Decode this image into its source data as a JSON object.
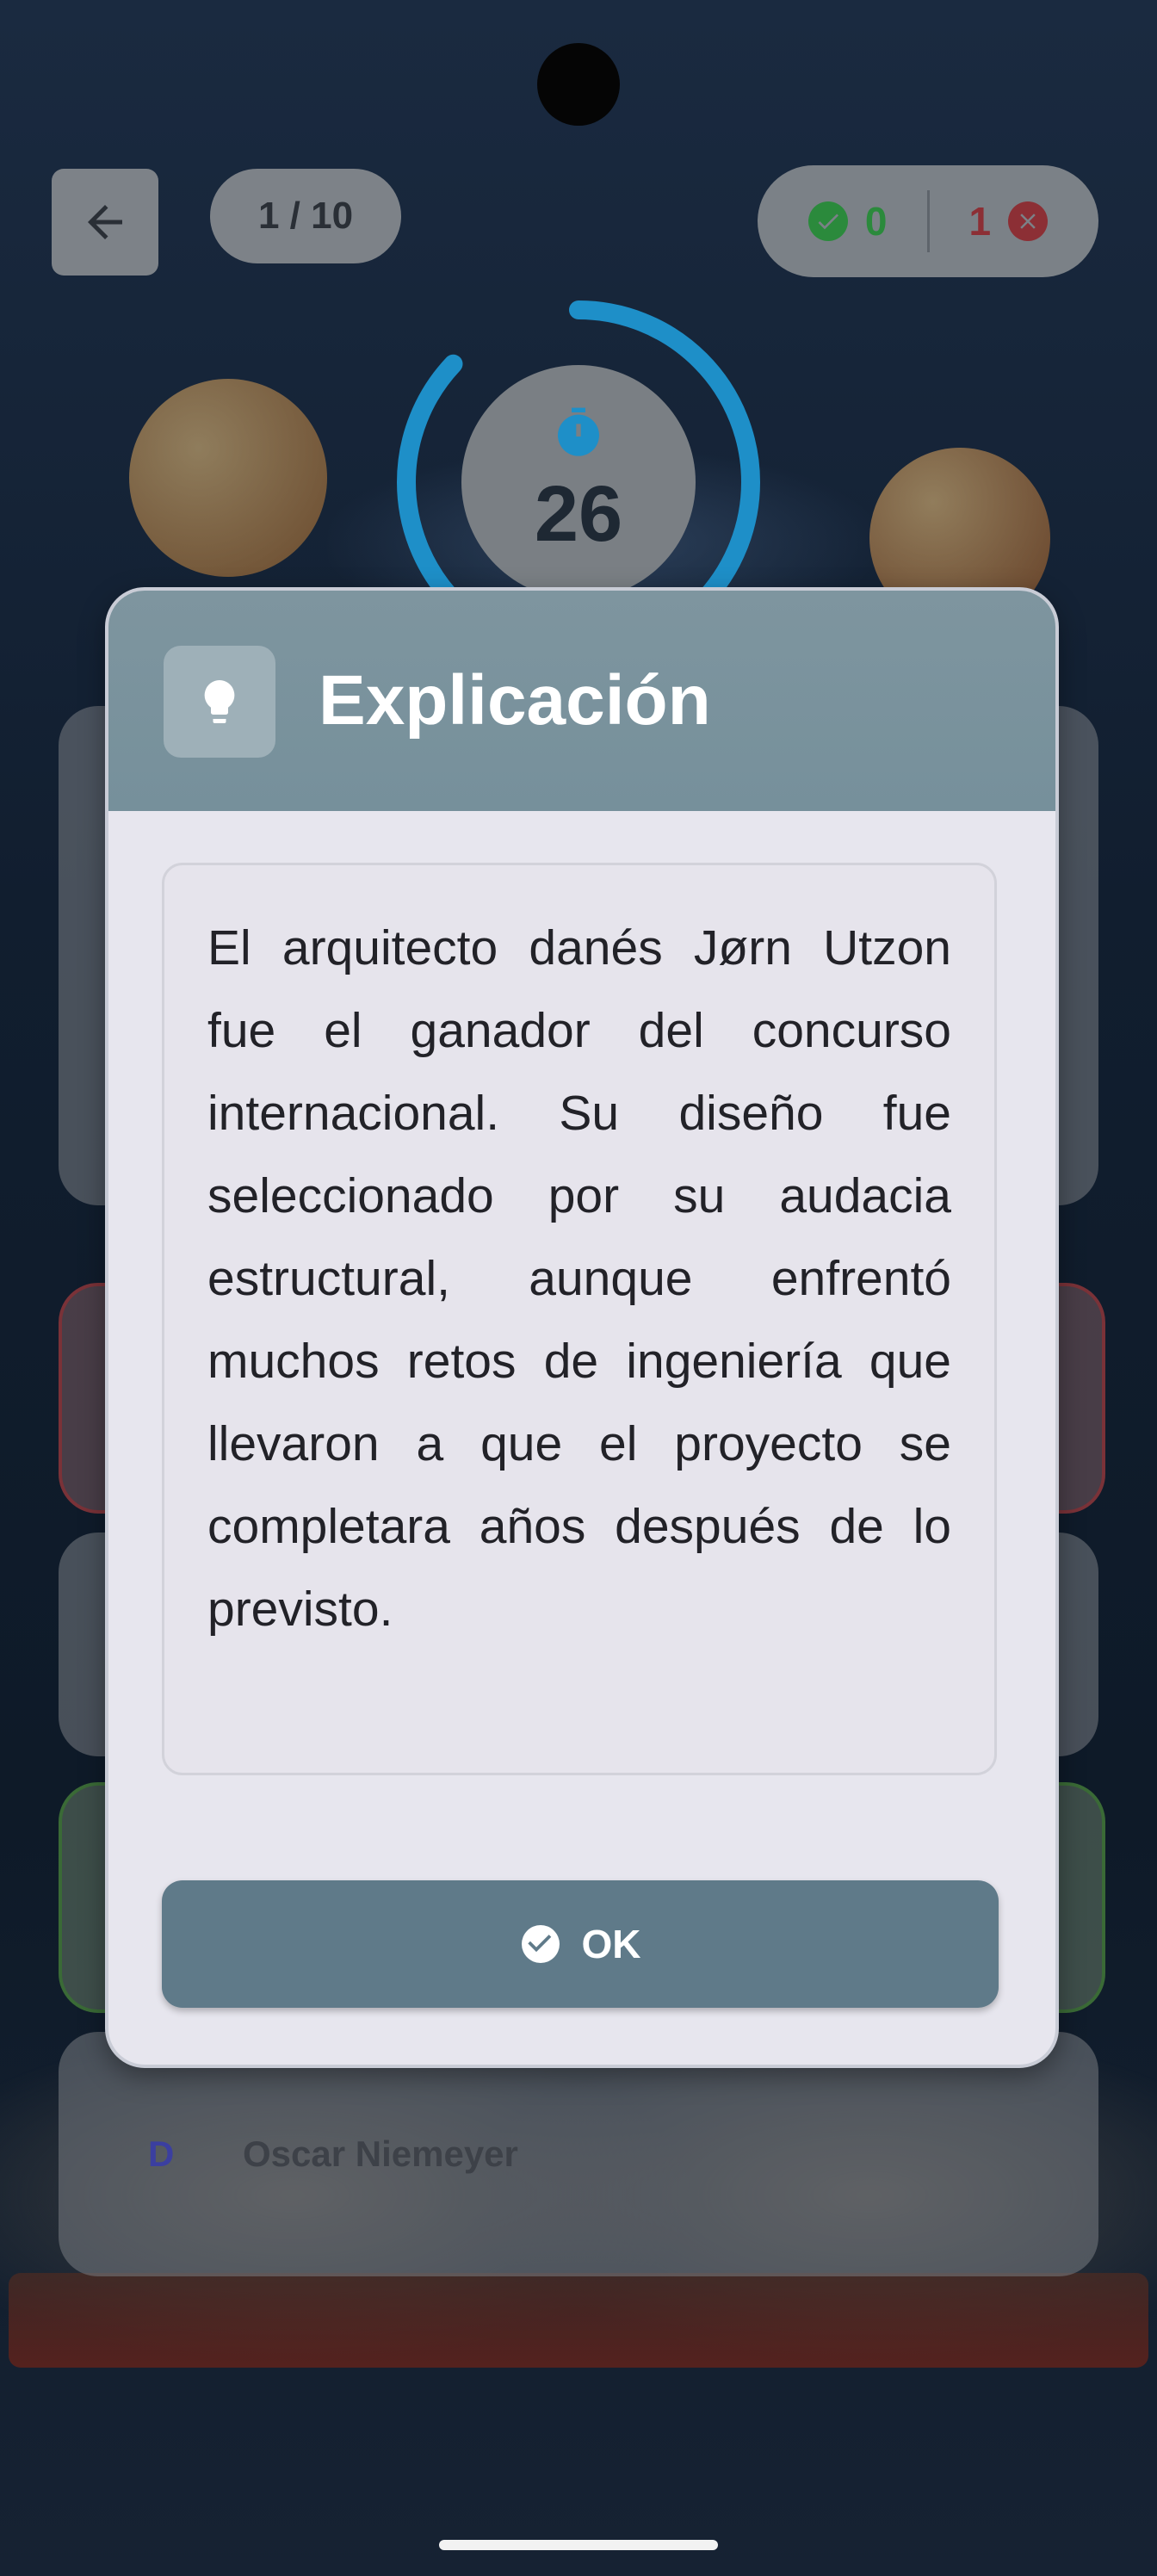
{
  "top_bar": {
    "progress": "1 / 10",
    "correct_count": "0",
    "wrong_count": "1"
  },
  "timer": {
    "seconds": "26",
    "remaining_fraction": 0.87
  },
  "options": [
    {
      "letter": "D",
      "text": "Oscar Niemeyer"
    }
  ],
  "dialog": {
    "title": "Explicación",
    "text": "El arquitecto danés Jørn Utzon fue el ganador del concurso internacional. Su diseño fue seleccionado por su audacia estructural, aunque enfrentó muchos retos de ingeniería que llevaron a que el proyecto se completara años después de lo previsto.",
    "ok_label": "OK"
  },
  "colors": {
    "header": "#7a939e",
    "ok_button": "#5f7a89",
    "timer_ring": "#1e8fc8",
    "correct": "#2b8a3c",
    "wrong": "#b3262e"
  },
  "icons": {
    "back": "arrow-left-icon",
    "correct": "check-circle-icon",
    "wrong": "close-circle-icon",
    "timer": "stopwatch-icon",
    "header": "lightbulb-icon",
    "ok": "check-circle-icon"
  }
}
